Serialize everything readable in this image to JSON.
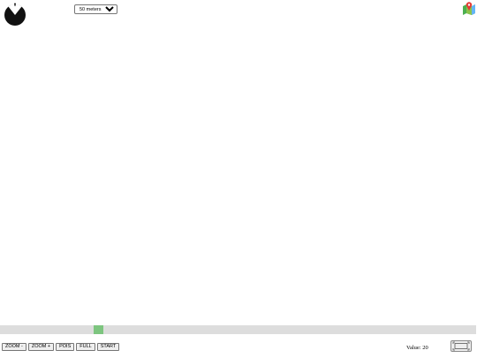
{
  "map": {
    "scale_select": {
      "selected": "50 meters"
    },
    "compass_icon": "compass-icon",
    "map_icon": "map-pin-icon"
  },
  "slider": {
    "position_fraction": 0.2,
    "handle_color": "#7dc57f",
    "track_color": "#dddddd"
  },
  "toolbar": {
    "zoom_out_label": "ZOOM -",
    "zoom_in_label": "ZOOM +",
    "pois_label": "POIS",
    "full_label": "FULL",
    "start_label": "START"
  },
  "status": {
    "value_label": "Value:",
    "value": "20"
  },
  "fullscreen": {
    "icon": "fullscreen-icon"
  }
}
